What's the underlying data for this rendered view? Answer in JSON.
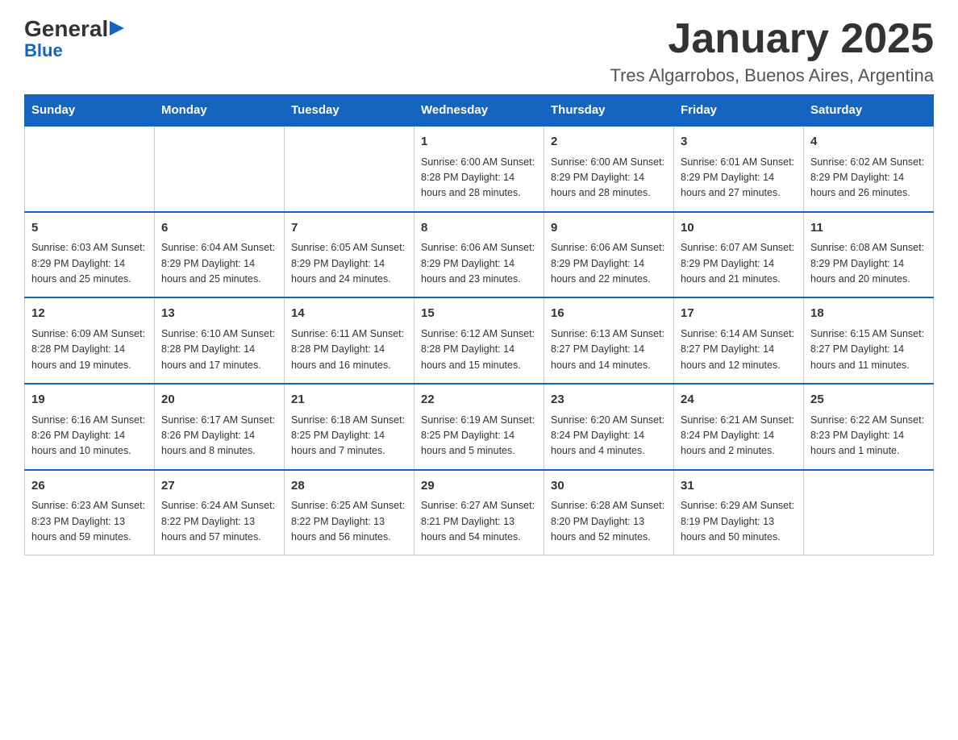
{
  "header": {
    "logo": {
      "general": "General",
      "blue": "Blue",
      "arrow": "▶"
    },
    "title": "January 2025",
    "location": "Tres Algarrobos, Buenos Aires, Argentina"
  },
  "weekdays": [
    "Sunday",
    "Monday",
    "Tuesday",
    "Wednesday",
    "Thursday",
    "Friday",
    "Saturday"
  ],
  "weeks": [
    {
      "days": [
        {
          "number": "",
          "info": ""
        },
        {
          "number": "",
          "info": ""
        },
        {
          "number": "",
          "info": ""
        },
        {
          "number": "1",
          "info": "Sunrise: 6:00 AM\nSunset: 8:28 PM\nDaylight: 14 hours and 28 minutes."
        },
        {
          "number": "2",
          "info": "Sunrise: 6:00 AM\nSunset: 8:29 PM\nDaylight: 14 hours and 28 minutes."
        },
        {
          "number": "3",
          "info": "Sunrise: 6:01 AM\nSunset: 8:29 PM\nDaylight: 14 hours and 27 minutes."
        },
        {
          "number": "4",
          "info": "Sunrise: 6:02 AM\nSunset: 8:29 PM\nDaylight: 14 hours and 26 minutes."
        }
      ]
    },
    {
      "days": [
        {
          "number": "5",
          "info": "Sunrise: 6:03 AM\nSunset: 8:29 PM\nDaylight: 14 hours and 25 minutes."
        },
        {
          "number": "6",
          "info": "Sunrise: 6:04 AM\nSunset: 8:29 PM\nDaylight: 14 hours and 25 minutes."
        },
        {
          "number": "7",
          "info": "Sunrise: 6:05 AM\nSunset: 8:29 PM\nDaylight: 14 hours and 24 minutes."
        },
        {
          "number": "8",
          "info": "Sunrise: 6:06 AM\nSunset: 8:29 PM\nDaylight: 14 hours and 23 minutes."
        },
        {
          "number": "9",
          "info": "Sunrise: 6:06 AM\nSunset: 8:29 PM\nDaylight: 14 hours and 22 minutes."
        },
        {
          "number": "10",
          "info": "Sunrise: 6:07 AM\nSunset: 8:29 PM\nDaylight: 14 hours and 21 minutes."
        },
        {
          "number": "11",
          "info": "Sunrise: 6:08 AM\nSunset: 8:29 PM\nDaylight: 14 hours and 20 minutes."
        }
      ]
    },
    {
      "days": [
        {
          "number": "12",
          "info": "Sunrise: 6:09 AM\nSunset: 8:28 PM\nDaylight: 14 hours and 19 minutes."
        },
        {
          "number": "13",
          "info": "Sunrise: 6:10 AM\nSunset: 8:28 PM\nDaylight: 14 hours and 17 minutes."
        },
        {
          "number": "14",
          "info": "Sunrise: 6:11 AM\nSunset: 8:28 PM\nDaylight: 14 hours and 16 minutes."
        },
        {
          "number": "15",
          "info": "Sunrise: 6:12 AM\nSunset: 8:28 PM\nDaylight: 14 hours and 15 minutes."
        },
        {
          "number": "16",
          "info": "Sunrise: 6:13 AM\nSunset: 8:27 PM\nDaylight: 14 hours and 14 minutes."
        },
        {
          "number": "17",
          "info": "Sunrise: 6:14 AM\nSunset: 8:27 PM\nDaylight: 14 hours and 12 minutes."
        },
        {
          "number": "18",
          "info": "Sunrise: 6:15 AM\nSunset: 8:27 PM\nDaylight: 14 hours and 11 minutes."
        }
      ]
    },
    {
      "days": [
        {
          "number": "19",
          "info": "Sunrise: 6:16 AM\nSunset: 8:26 PM\nDaylight: 14 hours and 10 minutes."
        },
        {
          "number": "20",
          "info": "Sunrise: 6:17 AM\nSunset: 8:26 PM\nDaylight: 14 hours and 8 minutes."
        },
        {
          "number": "21",
          "info": "Sunrise: 6:18 AM\nSunset: 8:25 PM\nDaylight: 14 hours and 7 minutes."
        },
        {
          "number": "22",
          "info": "Sunrise: 6:19 AM\nSunset: 8:25 PM\nDaylight: 14 hours and 5 minutes."
        },
        {
          "number": "23",
          "info": "Sunrise: 6:20 AM\nSunset: 8:24 PM\nDaylight: 14 hours and 4 minutes."
        },
        {
          "number": "24",
          "info": "Sunrise: 6:21 AM\nSunset: 8:24 PM\nDaylight: 14 hours and 2 minutes."
        },
        {
          "number": "25",
          "info": "Sunrise: 6:22 AM\nSunset: 8:23 PM\nDaylight: 14 hours and 1 minute."
        }
      ]
    },
    {
      "days": [
        {
          "number": "26",
          "info": "Sunrise: 6:23 AM\nSunset: 8:23 PM\nDaylight: 13 hours and 59 minutes."
        },
        {
          "number": "27",
          "info": "Sunrise: 6:24 AM\nSunset: 8:22 PM\nDaylight: 13 hours and 57 minutes."
        },
        {
          "number": "28",
          "info": "Sunrise: 6:25 AM\nSunset: 8:22 PM\nDaylight: 13 hours and 56 minutes."
        },
        {
          "number": "29",
          "info": "Sunrise: 6:27 AM\nSunset: 8:21 PM\nDaylight: 13 hours and 54 minutes."
        },
        {
          "number": "30",
          "info": "Sunrise: 6:28 AM\nSunset: 8:20 PM\nDaylight: 13 hours and 52 minutes."
        },
        {
          "number": "31",
          "info": "Sunrise: 6:29 AM\nSunset: 8:19 PM\nDaylight: 13 hours and 50 minutes."
        },
        {
          "number": "",
          "info": ""
        }
      ]
    }
  ]
}
